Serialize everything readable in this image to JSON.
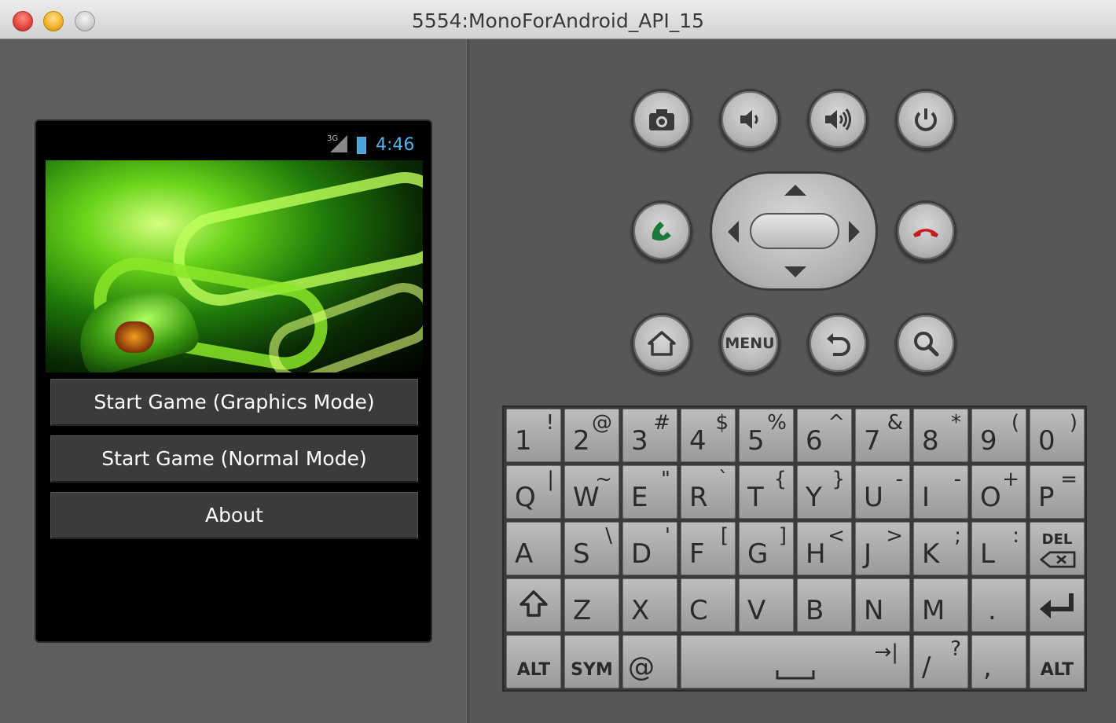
{
  "window": {
    "title": "5554:MonoForAndroid_API_15"
  },
  "phone": {
    "status": {
      "network": "3G",
      "time": "4:46"
    },
    "buttons": [
      "Start Game (Graphics Mode)",
      "Start Game (Normal Mode)",
      "About"
    ]
  },
  "hardware": {
    "top_row": [
      "camera-icon",
      "volume-down-icon",
      "volume-up-icon",
      "power-icon"
    ],
    "bottom_row": [
      "home-icon",
      "menu",
      "back-icon",
      "search-icon"
    ],
    "menu_label": "MENU"
  },
  "keyboard": {
    "row1": [
      {
        "main": "1",
        "alt": "!"
      },
      {
        "main": "2",
        "alt": "@"
      },
      {
        "main": "3",
        "alt": "#"
      },
      {
        "main": "4",
        "alt": "$"
      },
      {
        "main": "5",
        "alt": "%"
      },
      {
        "main": "6",
        "alt": "^"
      },
      {
        "main": "7",
        "alt": "&"
      },
      {
        "main": "8",
        "alt": "*"
      },
      {
        "main": "9",
        "alt": "("
      },
      {
        "main": "0",
        "alt": ")"
      }
    ],
    "row2": [
      {
        "main": "Q",
        "alt": "|"
      },
      {
        "main": "W",
        "alt": "~"
      },
      {
        "main": "E",
        "alt": "\""
      },
      {
        "main": "R",
        "alt": "`"
      },
      {
        "main": "T",
        "alt": "{"
      },
      {
        "main": "Y",
        "alt": "}"
      },
      {
        "main": "U",
        "alt": "-"
      },
      {
        "main": "I",
        "alt": "-"
      },
      {
        "main": "O",
        "alt": "+"
      },
      {
        "main": "P",
        "alt": "="
      }
    ],
    "row3": [
      {
        "main": "A",
        "alt": ""
      },
      {
        "main": "S",
        "alt": "\\"
      },
      {
        "main": "D",
        "alt": "'"
      },
      {
        "main": "F",
        "alt": "["
      },
      {
        "main": "G",
        "alt": "]"
      },
      {
        "main": "H",
        "alt": "<"
      },
      {
        "main": "J",
        "alt": ">"
      },
      {
        "main": "K",
        "alt": ";"
      },
      {
        "main": "L",
        "alt": ":"
      },
      {
        "main": "DEL",
        "alt": ""
      }
    ],
    "row4": [
      {
        "main": "⇧",
        "alt": ""
      },
      {
        "main": "Z",
        "alt": ""
      },
      {
        "main": "X",
        "alt": ""
      },
      {
        "main": "C",
        "alt": ""
      },
      {
        "main": "V",
        "alt": ""
      },
      {
        "main": "B",
        "alt": ""
      },
      {
        "main": "N",
        "alt": ""
      },
      {
        "main": "M",
        "alt": ""
      },
      {
        "main": ".",
        "alt": ""
      },
      {
        "main": "↵",
        "alt": ""
      }
    ],
    "row5": {
      "alt_left": "ALT",
      "sym": "SYM",
      "at": "@",
      "space_arrow": "→|",
      "slash": "/",
      "question": "?",
      "comma": ",",
      "alt_right": "ALT"
    }
  }
}
